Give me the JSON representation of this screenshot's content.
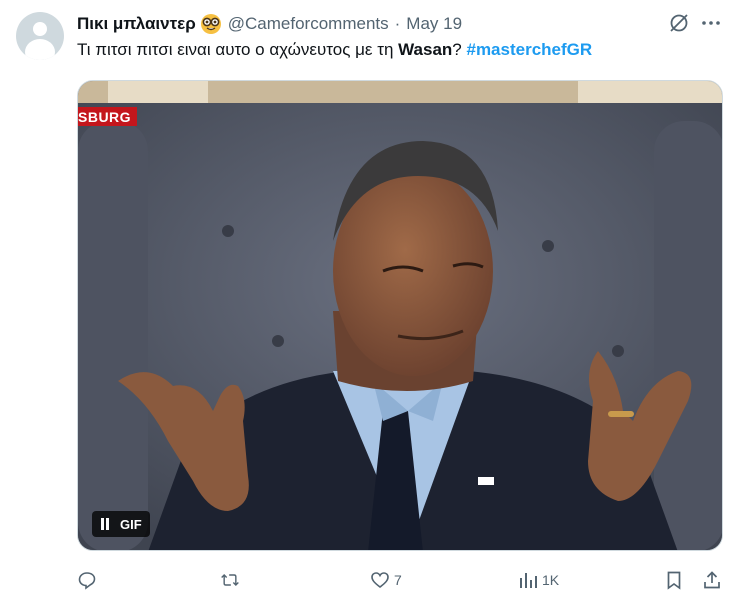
{
  "author": {
    "display_name": "Πικι μπλαιντερ",
    "emoji": "nerd-face-emoji",
    "handle": "@Cameforcomments",
    "separator": "·",
    "date": "May 19"
  },
  "tweet": {
    "text_before": "Τι πιτσι πιτσι ειναι αυτο ο αχώνευτος με τη ",
    "bold_word": "Wasan",
    "text_after": "? ",
    "hashtag": "#masterchefGR"
  },
  "media": {
    "badge_label": "GIF",
    "channel_tag": "SBURG",
    "icon": "pause-icon"
  },
  "actions": {
    "reply_count": "",
    "retweet_count": "",
    "like_count": "7",
    "views_count": "1K"
  },
  "colors": {
    "text": "#0f1419",
    "secondary": "#536471",
    "link": "#1d9bf0"
  }
}
